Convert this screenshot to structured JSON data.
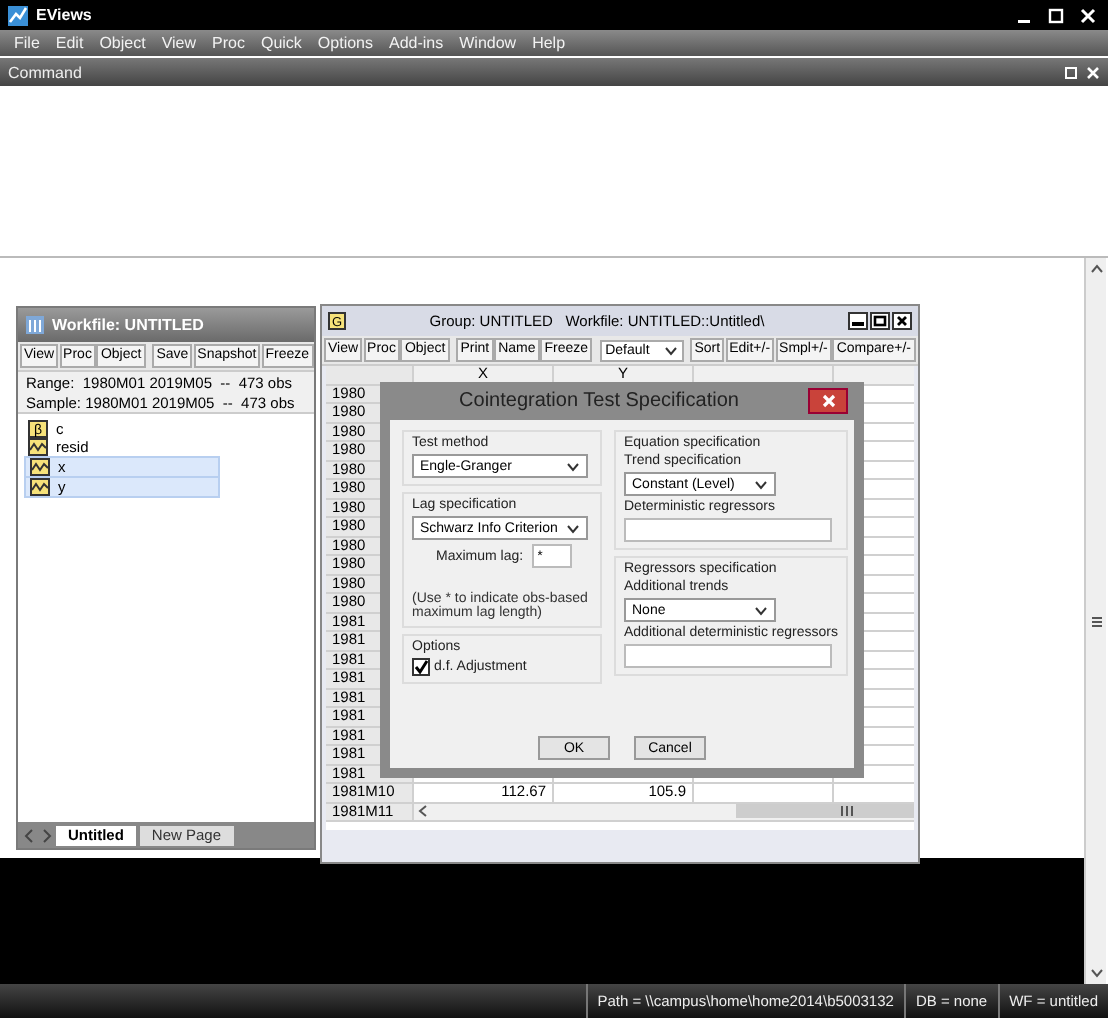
{
  "app": {
    "title": "EViews",
    "menu": [
      "File",
      "Edit",
      "Object",
      "View",
      "Proc",
      "Quick",
      "Options",
      "Add-ins",
      "Window",
      "Help"
    ]
  },
  "command": {
    "title": "Command"
  },
  "workfile": {
    "title": "Workfile: UNTITLED",
    "toolbar": [
      "View",
      "Proc",
      "Object",
      "Save",
      "Snapshot",
      "Freeze"
    ],
    "range": "Range:  1980M01 2019M05  --  473 obs",
    "sample": "Sample: 1980M01 2019M05  --  473 obs",
    "objects": [
      {
        "name": "c",
        "kind": "coef",
        "icon": "β",
        "selected": false
      },
      {
        "name": "resid",
        "kind": "series",
        "selected": false
      },
      {
        "name": "x",
        "kind": "series",
        "selected": true
      },
      {
        "name": "y",
        "kind": "series",
        "selected": true
      }
    ],
    "pages": [
      {
        "label": "Untitled",
        "selected": true
      },
      {
        "label": "New Page",
        "selected": false
      }
    ]
  },
  "group": {
    "icon": "G",
    "title": "Group: UNTITLED   Workfile: UNTITLED::Untitled\\",
    "toolbar": [
      "View",
      "Proc",
      "Object",
      "Print",
      "Name",
      "Freeze"
    ],
    "view_select": "Default",
    "toolbar_right": [
      "Sort",
      "Edit+/-",
      "Smpl+/-",
      "Compare+/-"
    ],
    "columns": [
      "X",
      "Y"
    ],
    "rows": [
      {
        "label": "1980"
      },
      {
        "label": "1980"
      },
      {
        "label": "1980"
      },
      {
        "label": "1980"
      },
      {
        "label": "1980"
      },
      {
        "label": "1980"
      },
      {
        "label": "1980"
      },
      {
        "label": "1980"
      },
      {
        "label": "1980"
      },
      {
        "label": "1980"
      },
      {
        "label": "1980"
      },
      {
        "label": "1980"
      },
      {
        "label": "1981"
      },
      {
        "label": "1981"
      },
      {
        "label": "1981"
      },
      {
        "label": "1981"
      },
      {
        "label": "1981"
      },
      {
        "label": "1981"
      },
      {
        "label": "1981"
      },
      {
        "label": "1981"
      },
      {
        "label": "1981"
      },
      {
        "label": "1981M10",
        "values": [
          "112.67",
          "105.9"
        ]
      },
      {
        "label": "1981M11"
      }
    ]
  },
  "dialog": {
    "title": "Cointegration Test Specification",
    "test_method": {
      "label": "Test method",
      "value": "Engle-Granger"
    },
    "lag_spec": {
      "label": "Lag specification",
      "value": "Schwarz Info Criterion"
    },
    "max_lag": {
      "label": "Maximum lag:",
      "value": "*"
    },
    "note": "(Use * to indicate obs-based maximum lag length)",
    "options": {
      "label": "Options",
      "checkbox": {
        "label": "d.f. Adjustment",
        "checked": true
      }
    },
    "equation_spec": {
      "label": "Equation specification",
      "trend_label": "Trend specification",
      "trend_value": "Constant (Level)",
      "det_label": "Deterministic regressors"
    },
    "regressors_spec": {
      "label": "Regressors specification",
      "trends_label": "Additional trends",
      "trends_value": "None",
      "det_label": "Additional deterministic regressors"
    },
    "buttons": [
      "OK",
      "Cancel"
    ]
  },
  "status_bar": [
    "Path = \\\\campus\\home\\home2014\\b5003132",
    "DB = none",
    "WF = untitled"
  ]
}
